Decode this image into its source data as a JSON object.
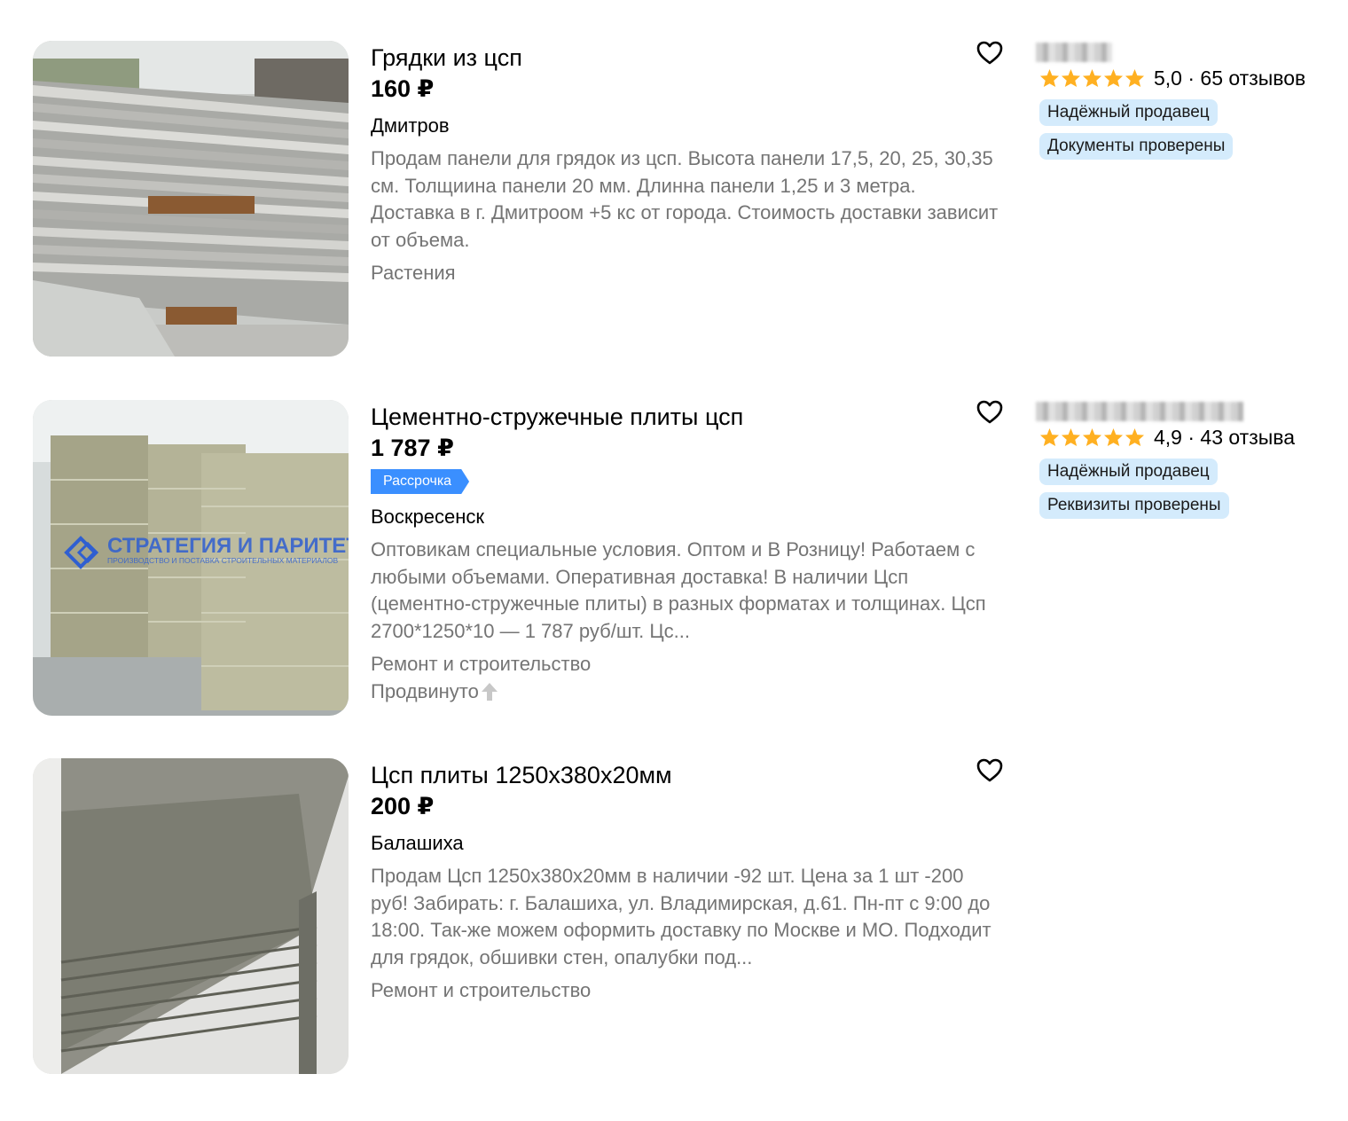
{
  "listings": [
    {
      "title": "Грядки из цсп",
      "price": "160 ₽",
      "location": "Дмитров",
      "description": "Продам панели для грядок из цсп. Высота панели 17,5, 20, 25, 30,35 см. Толщиина панели 20 мм. Длинна панели 1,25 и 3 метра. Доставка в г. Дмитроом +5 кс от города. Стоимость доставки зависит от объема.",
      "category": "Растения",
      "favorite_icon": "heart-icon",
      "seller": {
        "rating": "5,0 · 65 отзывов",
        "stars": 5,
        "chips": [
          "Надёжный продавец",
          "Документы проверены"
        ]
      }
    },
    {
      "title": "Цементно-стружечные плиты цсп",
      "price": "1 787 ₽",
      "badge": "Рассрочка",
      "location": "Воскресенск",
      "description": "Оптовикам специальные условия. Оптом и В Розницу! Работаем с любыми объемами. Оперативная доставка! В наличии Цсп (цементно-стружечные плиты) в разных форматах и толщинах. Цсп 2700*1250*10 — 1 787 руб/шт. Цс...",
      "category": "Ремонт и строительство",
      "promoted": "Продвинуто",
      "image_watermark": "СТРАТЕГИЯ И ПАРИТЕТ",
      "image_watermark_sub": "ПРОИЗВОДСТВО И ПОСТАВКА СТРОИТЕЛЬНЫХ МАТЕРИАЛОВ",
      "favorite_icon": "heart-icon",
      "seller": {
        "rating": "4,9 · 43 отзыва",
        "stars": 5,
        "chips": [
          "Надёжный продавец",
          "Реквизиты проверены"
        ]
      }
    },
    {
      "title": "Цсп плиты 1250x380x20мм",
      "price": "200 ₽",
      "location": "Балашиха",
      "description": "Продам Цсп 1250x380x20мм в наличии -92 шт. Цена за 1 шт -200 руб! Забирать: г. Балашиха, ул. Владимирская, д.61. Пн-пт с 9:00 до 18:00. Так-же можем оформить доставку по Москве и МО. Подходит для грядок, обшивки стен, опалубки под...",
      "category": "Ремонт и строительство",
      "favorite_icon": "heart-icon"
    }
  ],
  "colors": {
    "star": "#ffb021",
    "chip_bg": "#d4ebfc",
    "badge_bg": "#3a8fff",
    "muted_text": "#747474"
  }
}
